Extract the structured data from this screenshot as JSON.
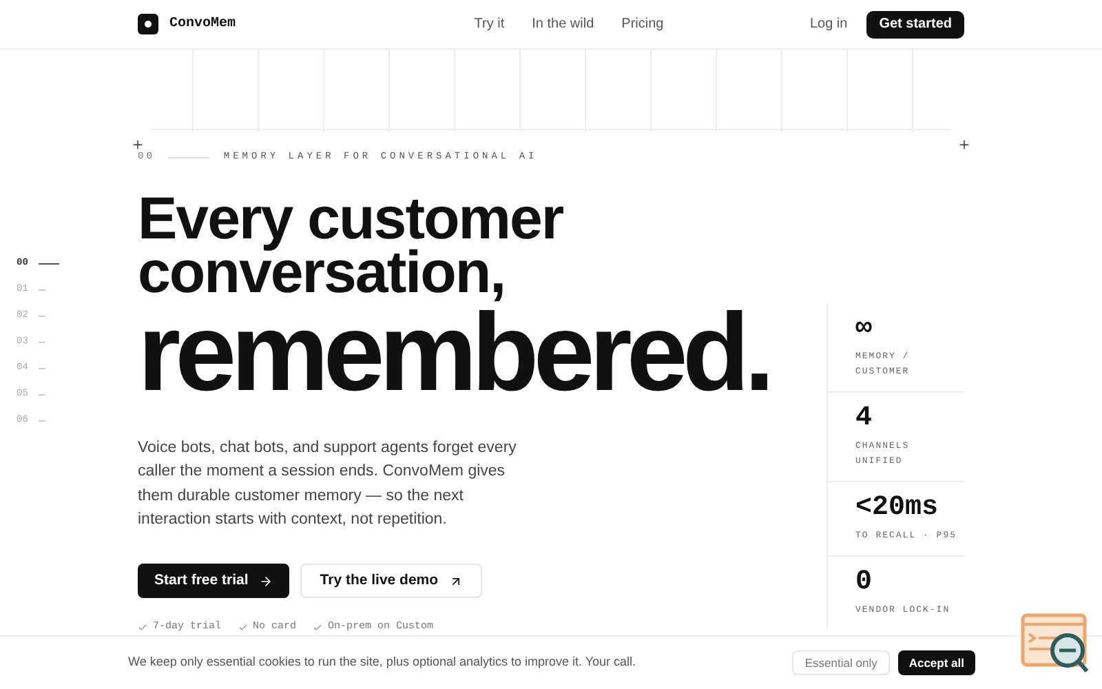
{
  "nav": {
    "brand": "ConvoMem",
    "links": [
      "Try it",
      "In the wild",
      "Pricing"
    ],
    "login": "Log in",
    "cta": "Get started"
  },
  "eyebrow": {
    "index": "00",
    "label": "MEMORY LAYER FOR CONVERSATIONAL AI"
  },
  "rail": [
    {
      "label": "00",
      "selected": true
    },
    {
      "label": "01",
      "selected": false
    },
    {
      "label": "02",
      "selected": false
    },
    {
      "label": "03",
      "selected": false
    },
    {
      "label": "04",
      "selected": false
    },
    {
      "label": "05",
      "selected": false
    },
    {
      "label": "06",
      "selected": false
    }
  ],
  "headline": {
    "line1": "Every customer",
    "line2": "conversation,",
    "line3": "remembered."
  },
  "intro": "Voice bots, chat bots, and support agents forget every caller the moment a session ends. ConvoMem gives them durable customer memory — so the next interaction starts with context, not repetition.",
  "actions": {
    "primary": "Start free trial",
    "secondary": "Try the live demo"
  },
  "perks": [
    "7-day trial",
    "No card",
    "On-prem on Custom"
  ],
  "stats": [
    {
      "value": "∞",
      "label": "MEMORY / CUSTOMER"
    },
    {
      "value": "4",
      "label": "CHANNELS UNIFIED"
    },
    {
      "value": "<20ms",
      "label": "TO RECALL · P95"
    },
    {
      "value": "0",
      "label": "VENDOR LOCK-IN"
    }
  ],
  "cookie": {
    "text": "We keep only essential cookies to run the site, plus optional analytics to improve it. Your call.",
    "decline": "Essential only",
    "accept": "Accept all"
  }
}
